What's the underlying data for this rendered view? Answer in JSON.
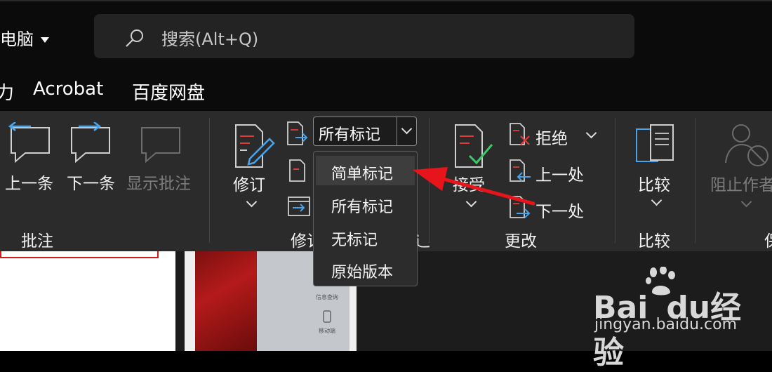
{
  "title_bar": {
    "account_label": "电脑",
    "search_placeholder": "搜索(Alt+Q)"
  },
  "menu": {
    "items": [
      {
        "label": "力"
      },
      {
        "label": "Acrobat"
      },
      {
        "label": "百度网盘"
      }
    ]
  },
  "ribbon": {
    "groups": {
      "comments": {
        "label": "批注",
        "buttons": {
          "previous": "上一条",
          "next": "下一条",
          "show_comments": "显示批注"
        }
      },
      "tracking": {
        "label_visible": "修订",
        "label_tail": "辶",
        "track_changes": "修订",
        "markup_combo_value": "所有标记"
      },
      "changes": {
        "label": "更改",
        "accept": "接受",
        "reject": "拒绝",
        "previous": "上一处",
        "next": "下一处"
      },
      "compare": {
        "label": "比较",
        "compare": "比较"
      },
      "protect": {
        "block_authors": "阻止作者",
        "label_partial": "保"
      }
    }
  },
  "markup_dropdown": {
    "options": [
      {
        "label": "简单标记",
        "highlighted": true
      },
      {
        "label": "所有标记",
        "highlighted": false
      },
      {
        "label": "无标记",
        "highlighted": false
      },
      {
        "label": "原始版本",
        "highlighted": false
      }
    ]
  },
  "document": {
    "side_labels": [
      "信息查询",
      "移动端"
    ]
  },
  "watermark": {
    "brand": "Bai",
    "brand_du": "du",
    "brand_suffix": "经验",
    "url": "jingyan.baidu.com"
  },
  "colors": {
    "annotation_arrow": "#e8141b",
    "accent_blue": "#4aa3e8",
    "accent_red": "#e03a3a",
    "accent_green": "#3cc86a"
  }
}
